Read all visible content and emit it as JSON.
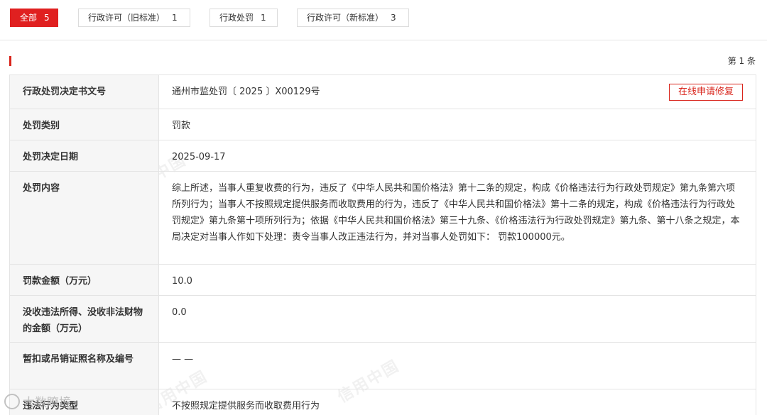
{
  "tabs": [
    {
      "label": "全部",
      "count": "5",
      "active": true
    },
    {
      "label": "行政许可（旧标准）",
      "count": "1",
      "active": false
    },
    {
      "label": "行政处罚",
      "count": "1",
      "active": false
    },
    {
      "label": "行政许可（新标准）",
      "count": "3",
      "active": false
    }
  ],
  "page_count": "第 1 条",
  "fix_button_label": "在线申请修复",
  "rows": [
    {
      "label": "行政处罚决定书文号",
      "value": "通州市监处罚〔 2025 〕X00129号"
    },
    {
      "label": "处罚类别",
      "value": "罚款"
    },
    {
      "label": "处罚决定日期",
      "value": "2025-09-17"
    },
    {
      "label": "处罚内容",
      "value": "综上所述，当事人重复收费的行为，违反了《中华人民共和国价格法》第十二条的规定，构成《价格违法行为行政处罚规定》第九条第六项所列行为；当事人不按照规定提供服务而收取费用的行为，违反了《中华人民共和国价格法》第十二条的规定，构成《价格违法行为行政处罚规定》第九条第十项所列行为；依据《中华人民共和国价格法》第三十九条、《价格违法行为行政处罚规定》第九条、第十八条之规定，本局决定对当事人作如下处理：责令当事人改正违法行为，并对当事人处罚如下： 罚款100000元。"
    },
    {
      "label": "罚款金额（万元）",
      "value": "10.0"
    },
    {
      "label": "没收违法所得、没收非法财物的金额（万元）",
      "value": "0.0"
    },
    {
      "label": "暂扣或吊销证照名称及编号",
      "value": "— —"
    },
    {
      "label": "违法行为类型",
      "value": "不按照规定提供服务而收取费用行为"
    }
  ],
  "watermark_text": "信用中国",
  "bottom_logo_text": "大数瞭境",
  "colors": {
    "accent": "#e02020",
    "label_bg": "#f6f6f6",
    "border": "#e4e4e4"
  }
}
